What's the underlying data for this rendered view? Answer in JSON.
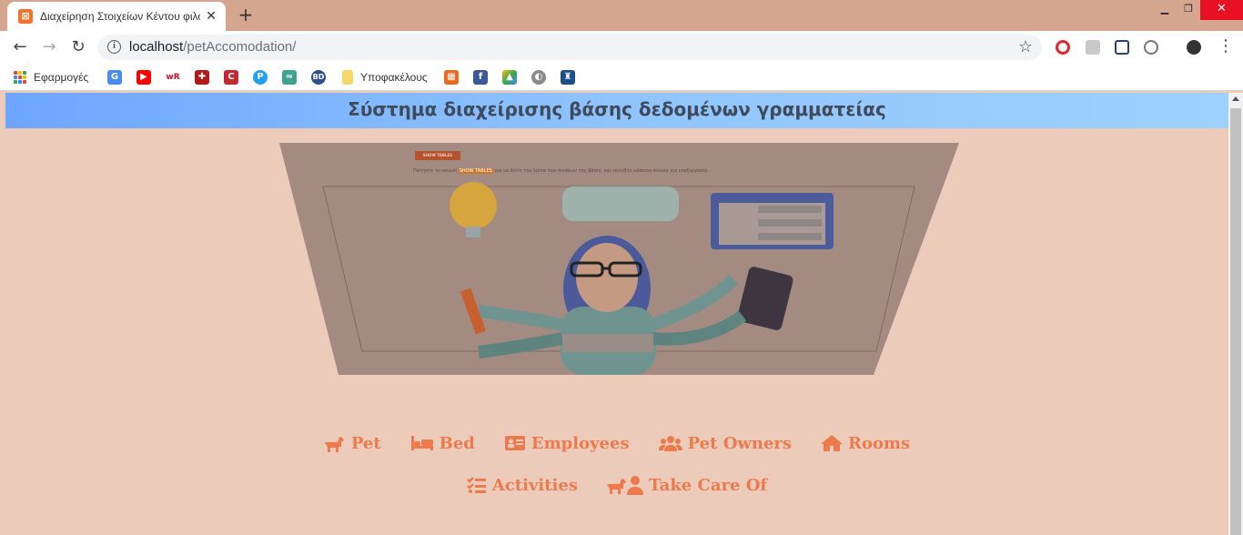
{
  "browser": {
    "tab_title": "Διαχείρηση Στοιχείων Κέντου φιλοξενίας",
    "url_host": "localhost",
    "url_path": "/petAccomodation/",
    "bookmarks_apps_label": "Εφαρμογές",
    "bookmarks_folder_label": "Υποφακέλους"
  },
  "page": {
    "banner_title": "Σύστημα διαχείρισης βάσης δεδομένων γραμματείας",
    "hero": {
      "button_label": "SHOW TABLES",
      "hint_before": "Πατήστε το κουμπί",
      "hint_mark": "SHOW TABLES",
      "hint_after": "για να δείτε την λίστα των πινάκων της βάσης και επιλέξτε κάποιον πίνακα για επεξεργασία"
    },
    "nav": {
      "pet": "Pet",
      "bed": "Bed",
      "employees": "Employees",
      "pet_owners": "Pet Owners",
      "rooms": "Rooms",
      "activities": "Activities",
      "take_care_of": "Take Care Of"
    }
  },
  "colors": {
    "page_bg": "#eccbbb",
    "chrome_bg": "#d4a68f",
    "nav_accent": "#ec7a4d",
    "banner_from": "#6ea6ff",
    "banner_to": "#9fd1ff",
    "banner_text": "#3f4a5a"
  }
}
